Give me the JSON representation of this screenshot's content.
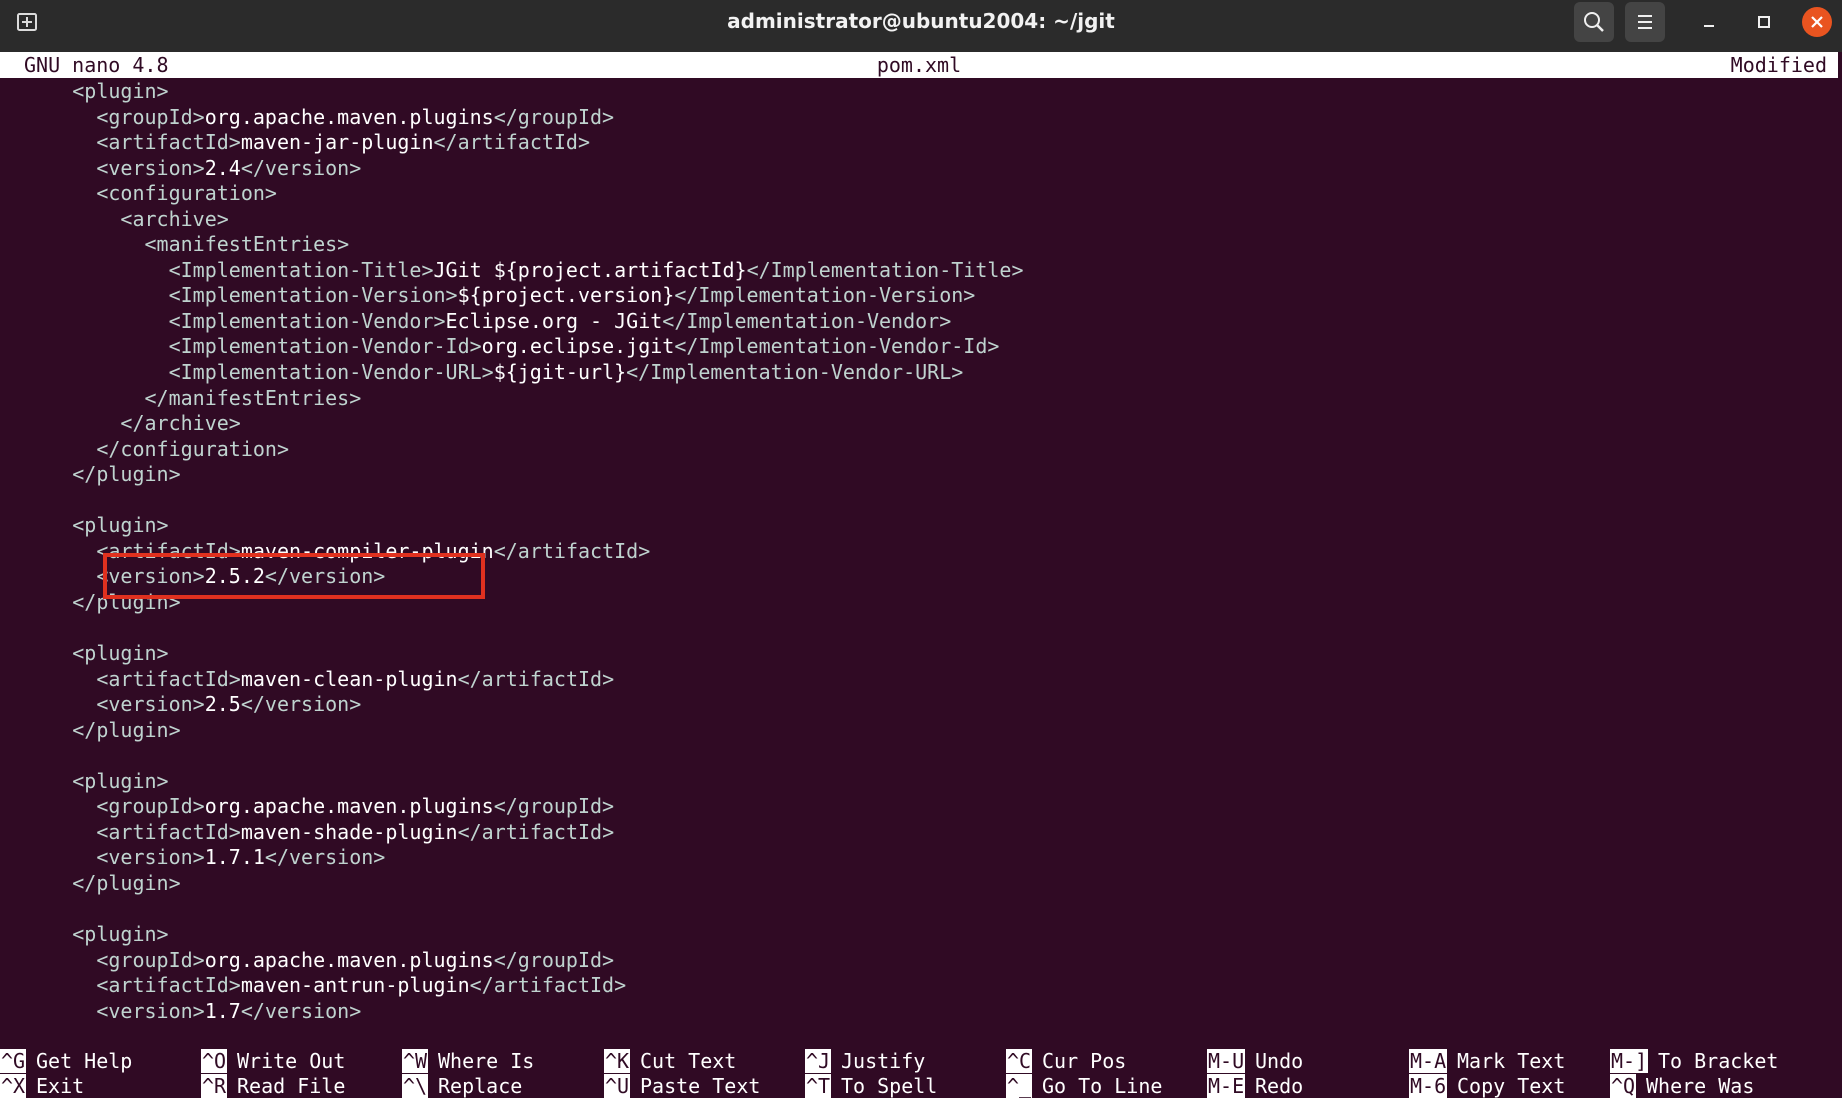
{
  "window": {
    "title": "administrator@ubuntu2004: ~/jgit"
  },
  "icons": {
    "new_tab": "new-tab-icon",
    "search": "search-icon",
    "menu": "hamburger-menu-icon",
    "minimize": "minimize-icon",
    "maximize": "maximize-icon",
    "close": "close-icon"
  },
  "nano": {
    "version": "GNU nano 4.8",
    "filename": "pom.xml",
    "status": "Modified"
  },
  "editor": {
    "lines": [
      [
        {
          "t": "      "
        },
        {
          "t": "<plugin>",
          "c": "tag"
        }
      ],
      [
        {
          "t": "        "
        },
        {
          "t": "<groupId>",
          "c": "tag"
        },
        {
          "t": "org.apache.maven.plugins"
        },
        {
          "t": "</groupId>",
          "c": "tag"
        }
      ],
      [
        {
          "t": "        "
        },
        {
          "t": "<artifactId>",
          "c": "tag"
        },
        {
          "t": "maven-jar-plugin"
        },
        {
          "t": "</artifactId>",
          "c": "tag"
        }
      ],
      [
        {
          "t": "        "
        },
        {
          "t": "<version>",
          "c": "tag"
        },
        {
          "t": "2.4"
        },
        {
          "t": "</version>",
          "c": "tag"
        }
      ],
      [
        {
          "t": "        "
        },
        {
          "t": "<configuration>",
          "c": "tag"
        }
      ],
      [
        {
          "t": "          "
        },
        {
          "t": "<archive>",
          "c": "tag"
        }
      ],
      [
        {
          "t": "            "
        },
        {
          "t": "<manifestEntries>",
          "c": "tag"
        }
      ],
      [
        {
          "t": "              "
        },
        {
          "t": "<Implementation-Title>",
          "c": "tag"
        },
        {
          "t": "JGit ${project.artifactId}"
        },
        {
          "t": "</Implementation-Title>",
          "c": "tag"
        }
      ],
      [
        {
          "t": "              "
        },
        {
          "t": "<Implementation-Version>",
          "c": "tag"
        },
        {
          "t": "${project.version}"
        },
        {
          "t": "</Implementation-Version>",
          "c": "tag"
        }
      ],
      [
        {
          "t": "              "
        },
        {
          "t": "<Implementation-Vendor>",
          "c": "tag"
        },
        {
          "t": "Eclipse.org - JGit"
        },
        {
          "t": "</Implementation-Vendor>",
          "c": "tag"
        }
      ],
      [
        {
          "t": "              "
        },
        {
          "t": "<Implementation-Vendor-Id>",
          "c": "tag"
        },
        {
          "t": "org.eclipse.jgit"
        },
        {
          "t": "</Implementation-Vendor-Id>",
          "c": "tag"
        }
      ],
      [
        {
          "t": "              "
        },
        {
          "t": "<Implementation-Vendor-URL>",
          "c": "tag"
        },
        {
          "t": "${jgit-url}"
        },
        {
          "t": "</Implementation-Vendor-URL>",
          "c": "tag"
        }
      ],
      [
        {
          "t": "            "
        },
        {
          "t": "</manifestEntries>",
          "c": "tag"
        }
      ],
      [
        {
          "t": "          "
        },
        {
          "t": "</archive>",
          "c": "tag"
        }
      ],
      [
        {
          "t": "        "
        },
        {
          "t": "</configuration>",
          "c": "tag"
        }
      ],
      [
        {
          "t": "      "
        },
        {
          "t": "</plugin>",
          "c": "tag"
        }
      ],
      [
        {
          "t": ""
        }
      ],
      [
        {
          "t": "      "
        },
        {
          "t": "<plugin>",
          "c": "tag"
        }
      ],
      [
        {
          "t": "        "
        },
        {
          "t": "<artifactId>",
          "c": "tag"
        },
        {
          "t": "maven-compiler-plugin"
        },
        {
          "t": "</artifactId>",
          "c": "tag"
        }
      ],
      [
        {
          "t": "        "
        },
        {
          "t": "<version>",
          "c": "tag"
        },
        {
          "t": "2.5.2"
        },
        {
          "t": "</version>",
          "c": "tag"
        }
      ],
      [
        {
          "t": "      "
        },
        {
          "t": "</plugin>",
          "c": "tag"
        }
      ],
      [
        {
          "t": ""
        }
      ],
      [
        {
          "t": "      "
        },
        {
          "t": "<plugin>",
          "c": "tag"
        }
      ],
      [
        {
          "t": "        "
        },
        {
          "t": "<artifactId>",
          "c": "tag"
        },
        {
          "t": "maven-clean-plugin"
        },
        {
          "t": "</artifactId>",
          "c": "tag"
        }
      ],
      [
        {
          "t": "        "
        },
        {
          "t": "<version>",
          "c": "tag"
        },
        {
          "t": "2.5"
        },
        {
          "t": "</version>",
          "c": "tag"
        }
      ],
      [
        {
          "t": "      "
        },
        {
          "t": "</plugin>",
          "c": "tag"
        }
      ],
      [
        {
          "t": ""
        }
      ],
      [
        {
          "t": "      "
        },
        {
          "t": "<plugin>",
          "c": "tag"
        }
      ],
      [
        {
          "t": "        "
        },
        {
          "t": "<groupId>",
          "c": "tag"
        },
        {
          "t": "org.apache.maven.plugins"
        },
        {
          "t": "</groupId>",
          "c": "tag"
        }
      ],
      [
        {
          "t": "        "
        },
        {
          "t": "<artifactId>",
          "c": "tag"
        },
        {
          "t": "maven-shade-plugin"
        },
        {
          "t": "</artifactId>",
          "c": "tag"
        }
      ],
      [
        {
          "t": "        "
        },
        {
          "t": "<version>",
          "c": "tag"
        },
        {
          "t": "1.7.1"
        },
        {
          "t": "</version>",
          "c": "tag"
        }
      ],
      [
        {
          "t": "      "
        },
        {
          "t": "</plugin>",
          "c": "tag"
        }
      ],
      [
        {
          "t": ""
        }
      ],
      [
        {
          "t": "      "
        },
        {
          "t": "<plugin>",
          "c": "tag"
        }
      ],
      [
        {
          "t": "        "
        },
        {
          "t": "<groupId>",
          "c": "tag"
        },
        {
          "t": "org.apache.maven.plugins"
        },
        {
          "t": "</groupId>",
          "c": "tag"
        }
      ],
      [
        {
          "t": "        "
        },
        {
          "t": "<artifactId>",
          "c": "tag"
        },
        {
          "t": "maven-antrun-plugin"
        },
        {
          "t": "</artifactId>",
          "c": "tag"
        }
      ],
      [
        {
          "t": "        "
        },
        {
          "t": "<version>",
          "c": "tag"
        },
        {
          "t": "1.7"
        },
        {
          "t": "</version>",
          "c": "tag"
        }
      ]
    ]
  },
  "shortcuts": [
    [
      {
        "key": "^G",
        "label": "Get Help"
      },
      {
        "key": "^X",
        "label": "Exit"
      }
    ],
    [
      {
        "key": "^O",
        "label": "Write Out"
      },
      {
        "key": "^R",
        "label": "Read File"
      }
    ],
    [
      {
        "key": "^W",
        "label": "Where Is"
      },
      {
        "key": "^\\",
        "label": "Replace"
      }
    ],
    [
      {
        "key": "^K",
        "label": "Cut Text"
      },
      {
        "key": "^U",
        "label": "Paste Text"
      }
    ],
    [
      {
        "key": "^J",
        "label": "Justify"
      },
      {
        "key": "^T",
        "label": "To Spell"
      }
    ],
    [
      {
        "key": "^C",
        "label": "Cur Pos"
      },
      {
        "key": "^_",
        "label": "Go To Line"
      }
    ],
    [
      {
        "key": "M-U",
        "label": "Undo"
      },
      {
        "key": "M-E",
        "label": "Redo"
      }
    ],
    [
      {
        "key": "M-A",
        "label": "Mark Text"
      },
      {
        "key": "M-6",
        "label": "Copy Text"
      }
    ],
    [
      {
        "key": "M-]",
        "label": "To Bracket"
      },
      {
        "key": "^Q",
        "label": "Where Was"
      }
    ]
  ],
  "colors": {
    "background": "#300a24",
    "tag": "#bfd3cf",
    "text": "#ffffff",
    "highlight": "#e0311f",
    "close": "#e95420"
  }
}
